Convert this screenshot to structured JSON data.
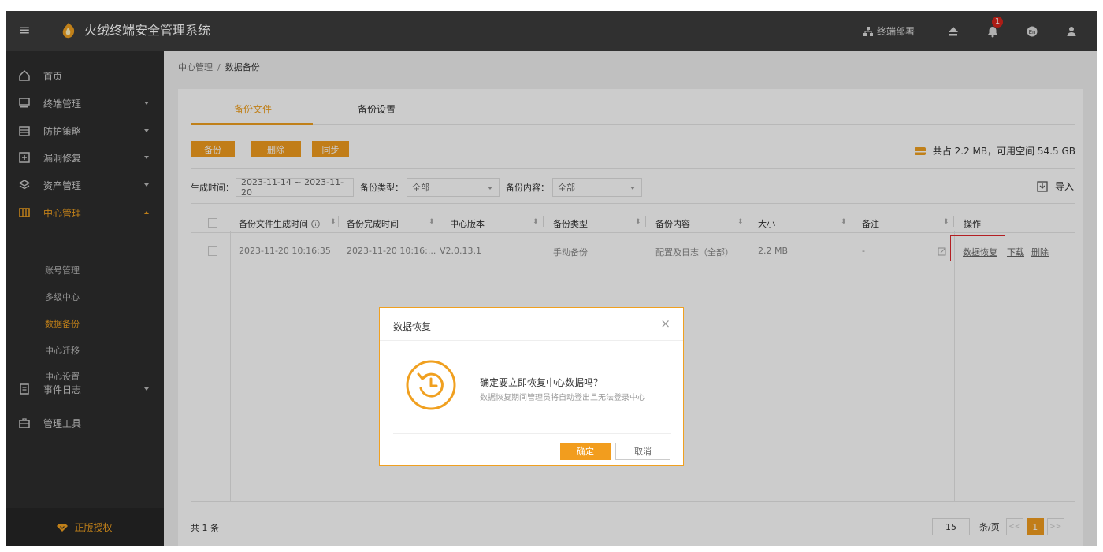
{
  "app": {
    "title": "火绒终端安全管理系统"
  },
  "topbar": {
    "deploy_label": "终端部署",
    "notification_count": "1",
    "icons": [
      "menu-icon",
      "logo-icon",
      "deploy-icon",
      "upload-icon",
      "bell-icon",
      "language-icon",
      "user-icon"
    ]
  },
  "sidebar": {
    "items": [
      {
        "label": "首页",
        "icon": "home-icon"
      },
      {
        "label": "终端管理",
        "icon": "monitor-icon"
      },
      {
        "label": "防护策略",
        "icon": "policy-icon"
      },
      {
        "label": "漏洞修复",
        "icon": "plus-box-icon"
      },
      {
        "label": "资产管理",
        "icon": "layers-icon"
      },
      {
        "label": "中心管理",
        "icon": "center-icon"
      },
      {
        "label": "事件日志",
        "icon": "log-icon"
      },
      {
        "label": "管理工具",
        "icon": "toolbox-icon"
      }
    ],
    "subitems": [
      "账号管理",
      "多级中心",
      "数据备份",
      "中心迁移",
      "中心设置"
    ],
    "license": "正版授权"
  },
  "breadcrumb": {
    "parent": "中心管理",
    "separator": "/",
    "current": "数据备份"
  },
  "tabs": [
    "备份文件",
    "备份设置"
  ],
  "toolbar": {
    "backup": "备份",
    "delete": "删除",
    "sync": "同步",
    "storage": "共占 2.2 MB，可用空间 54.5 GB"
  },
  "filters": {
    "time_label": "生成时间：",
    "time_value": "2023-11-14 ~ 2023-11-20",
    "type_label": "备份类型：",
    "type_value": "全部",
    "content_label": "备份内容：",
    "content_value": "全部",
    "import": "导入"
  },
  "table": {
    "headers": [
      "备份文件生成时间",
      "备份完成时间",
      "中心版本",
      "备份类型",
      "备份内容",
      "大小",
      "备注",
      "操作"
    ],
    "rows": [
      {
        "created": "2023-11-20 10:16:35",
        "completed": "2023-11-20 10:16:...",
        "version": "V2.0.13.1",
        "type": "手动备份",
        "content": "配置及日志（全部）",
        "size": "2.2 MB",
        "note": "-",
        "actions": [
          "数据恢复",
          "下载",
          "删除"
        ]
      }
    ]
  },
  "footer": {
    "total": "共 1 条",
    "page_size": "15",
    "per_page": "条/页",
    "prev": "<<",
    "page": "1",
    "next": ">>"
  },
  "dialog": {
    "title": "数据恢复",
    "close": "×",
    "question": "确定要立即恢复中心数据吗？",
    "description": "数据恢复期间管理员将自动登出且无法登录中心",
    "ok": "确定",
    "cancel": "取消"
  },
  "colors": {
    "accent": "#f29d1e",
    "topbar": "#3c3c3c",
    "sidebar": "#2d2d2d",
    "highlight_box": "#e0262b",
    "badge": "#d9251c"
  }
}
